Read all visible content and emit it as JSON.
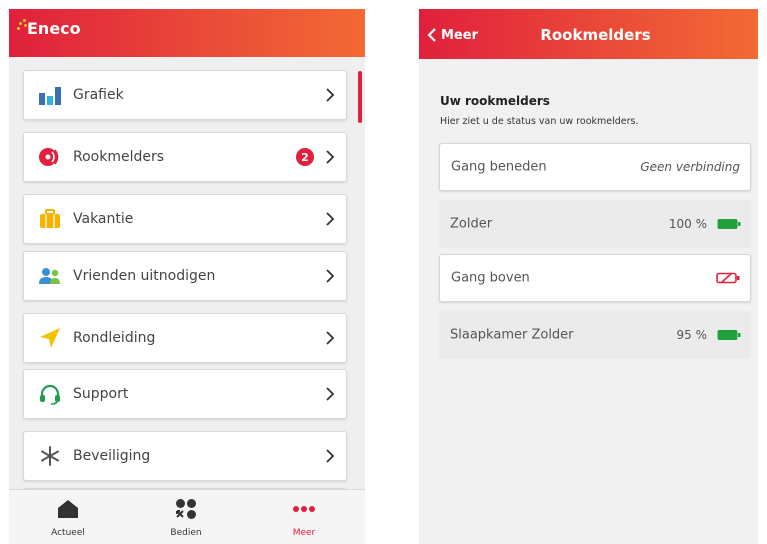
{
  "colors": {
    "brand_red": "#e0203d",
    "brand_orange": "#f26a34",
    "battery_ok": "#22a03a",
    "battery_empty": "#e0203d"
  },
  "left_screen": {
    "logo_text": "Eneco",
    "menu": [
      {
        "label": "Grafiek",
        "icon": "bar-chart-icon"
      },
      {
        "label": "Rookmelders",
        "icon": "smoke-detector-icon",
        "badge": "2"
      },
      {
        "label": "Vakantie",
        "icon": "suitcase-icon"
      },
      {
        "label": "Vrienden uitnodigen",
        "icon": "friends-icon"
      },
      {
        "label": "Rondleiding",
        "icon": "navigation-arrow-icon"
      },
      {
        "label": "Support",
        "icon": "headset-icon"
      },
      {
        "label": "Beveiliging",
        "icon": "asterisk-icon"
      }
    ],
    "tabbar": [
      {
        "label": "Actueel",
        "icon": "home-icon"
      },
      {
        "label": "Bedien",
        "icon": "control-icon"
      },
      {
        "label": "Meer",
        "icon": "more-dots-icon",
        "active": true
      }
    ]
  },
  "right_screen": {
    "back_label": "Meer",
    "title": "Rookmelders",
    "section_title": "Uw rookmelders",
    "section_subtitle": "Hier ziet u de status van uw rookmelders.",
    "detectors": [
      {
        "name": "Gang beneden",
        "status_text": "Geen verbinding",
        "battery": null
      },
      {
        "name": "Zolder",
        "status_text": "100 %",
        "battery": 1.0
      },
      {
        "name": "Gang boven",
        "status_text": "",
        "battery": 0.0
      },
      {
        "name": "Slaapkamer Zolder",
        "status_text": "95 %",
        "battery": 0.95
      }
    ]
  }
}
